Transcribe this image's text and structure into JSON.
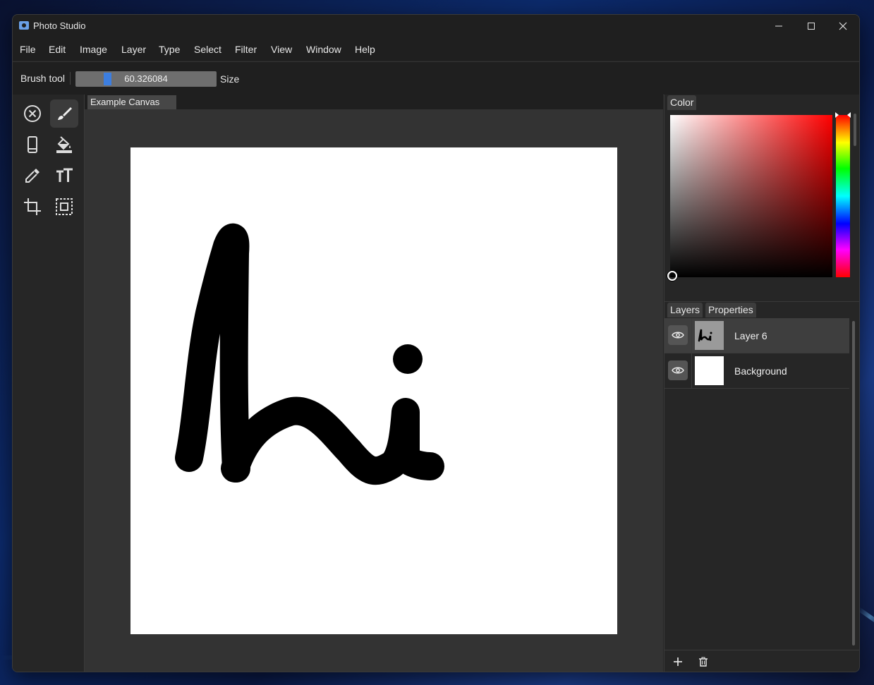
{
  "window": {
    "title": "Photo Studio"
  },
  "menu": [
    "File",
    "Edit",
    "Image",
    "Layer",
    "Type",
    "Select",
    "Filter",
    "View",
    "Window",
    "Help"
  ],
  "toolbar": {
    "tool_name": "Brush tool",
    "size_value": "60.326084",
    "size_label": "Size",
    "size_fraction": 0.24
  },
  "tools": [
    {
      "name": "cancel-tool",
      "icon": "circle-x-icon",
      "active": false
    },
    {
      "name": "brush-tool",
      "icon": "brush-icon",
      "active": true
    },
    {
      "name": "eraser-tool",
      "icon": "rectangle-icon",
      "active": false
    },
    {
      "name": "fill-tool",
      "icon": "paint-bucket-icon",
      "active": false
    },
    {
      "name": "eyedropper-tool",
      "icon": "eyedropper-icon",
      "active": false
    },
    {
      "name": "text-tool",
      "icon": "text-size-icon",
      "active": false
    },
    {
      "name": "crop-tool",
      "icon": "crop-icon",
      "active": false
    },
    {
      "name": "select-tool",
      "icon": "selection-icon",
      "active": false
    }
  ],
  "document": {
    "tab_label": "Example Canvas"
  },
  "color_panel": {
    "tab_label": "Color",
    "hue": "#ff0000",
    "selected_color": "#000000"
  },
  "layers_panel": {
    "tabs": [
      "Layers",
      "Properties"
    ],
    "layers": [
      {
        "name": "Layer 6",
        "selected": true,
        "visible": true
      },
      {
        "name": "Background",
        "selected": false,
        "visible": true
      }
    ],
    "footer": {
      "add_icon": "plus-icon",
      "delete_icon": "trash-icon"
    }
  }
}
